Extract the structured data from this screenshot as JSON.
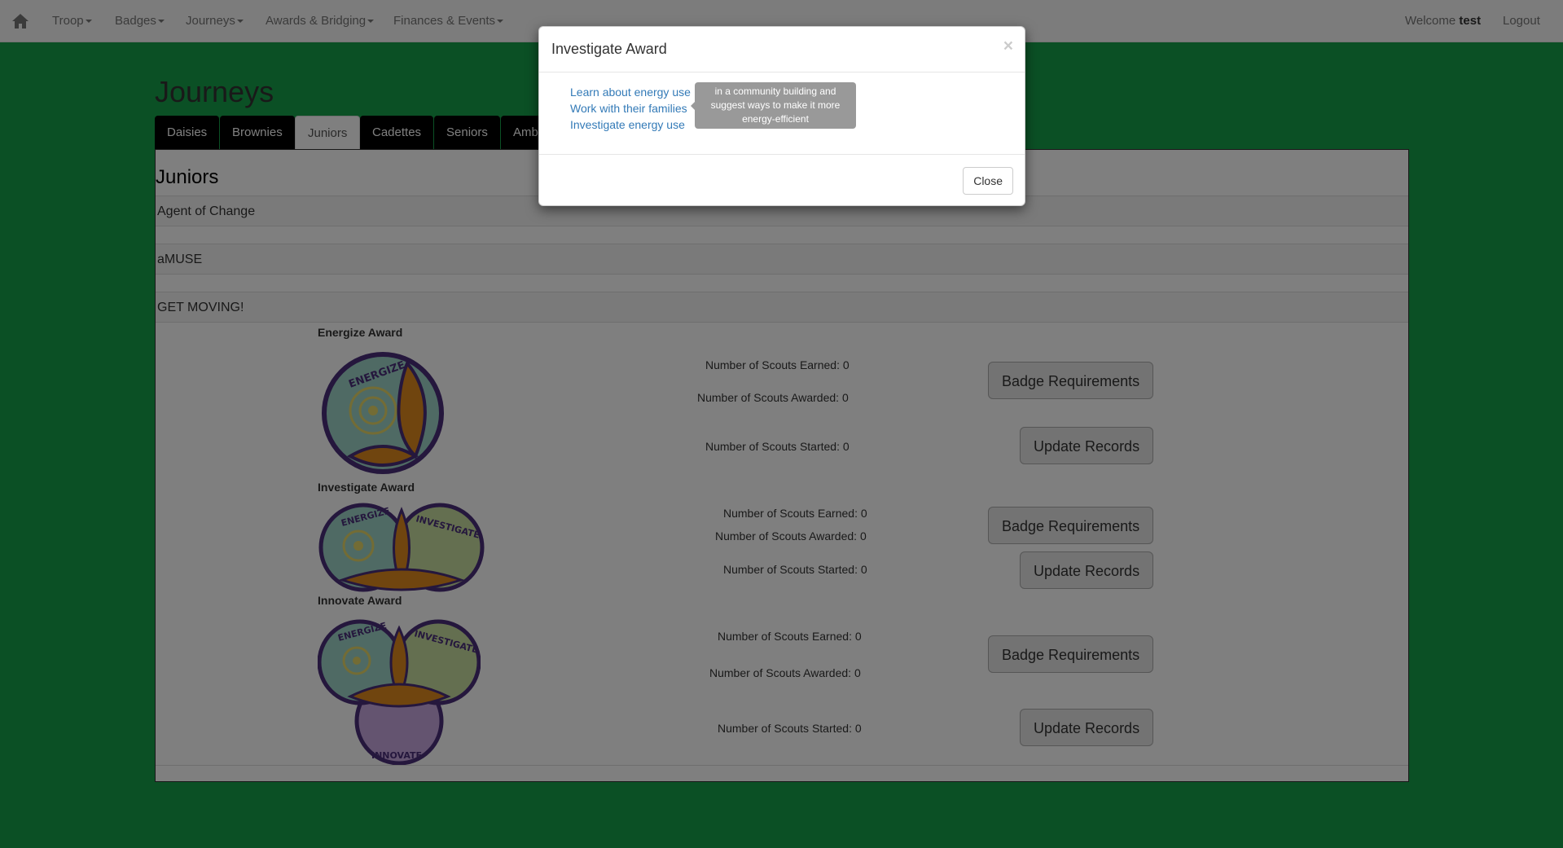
{
  "navbar": {
    "home_icon": "home-icon",
    "menus": [
      "Troop",
      "Badges",
      "Journeys",
      "Awards & Bridging",
      "Finances & Events"
    ],
    "welcome_prefix": "Welcome",
    "username": "test",
    "logout": "Logout"
  },
  "page": {
    "title": "Journeys",
    "tabs": [
      "Daisies",
      "Brownies",
      "Juniors",
      "Cadettes",
      "Seniors",
      "Amb"
    ],
    "active_tab": "Juniors"
  },
  "panel": {
    "heading": "Juniors",
    "journeys": [
      "Agent of Change",
      "aMUSE",
      "GET MOVING!"
    ]
  },
  "awards": [
    {
      "title": "Energize Award",
      "earned": "Number of Scouts Earned: 0",
      "awarded": "Number of Scouts Awarded: 0",
      "started": "Number of Scouts Started: 0",
      "badge_button": "Badge Requirements",
      "update_button": "Update Records"
    },
    {
      "title": "Investigate Award",
      "earned": "Number of Scouts Earned: 0",
      "awarded": "Number of Scouts Awarded: 0",
      "started": "Number of Scouts Started: 0",
      "badge_button": "Badge Requirements",
      "update_button": "Update Records"
    },
    {
      "title": "Innovate Award",
      "earned": "Number of Scouts Earned: 0",
      "awarded": "Number of Scouts Awarded: 0",
      "started": "Number of Scouts Started: 0",
      "badge_button": "Badge Requirements",
      "update_button": "Update Records"
    }
  ],
  "badge_text": {
    "energize": "ENERGIZE",
    "investigate": "INVESTIGATE",
    "innovate": "INNOVATE"
  },
  "modal": {
    "title": "Investigate Award",
    "close_x": "×",
    "requirements": [
      "Learn about energy use",
      "Work with their families",
      "Investigate energy use"
    ],
    "tooltip": "in a community building and suggest ways to make it more energy-efficient",
    "close_button": "Close"
  },
  "colors": {
    "page_background": "#17a14a",
    "tab_background": "#000000",
    "link": "#337ab7",
    "badge_border": "#4a2f7a",
    "badge_orange": "#e08a1e",
    "badge_teal": "#9ed4c8"
  }
}
